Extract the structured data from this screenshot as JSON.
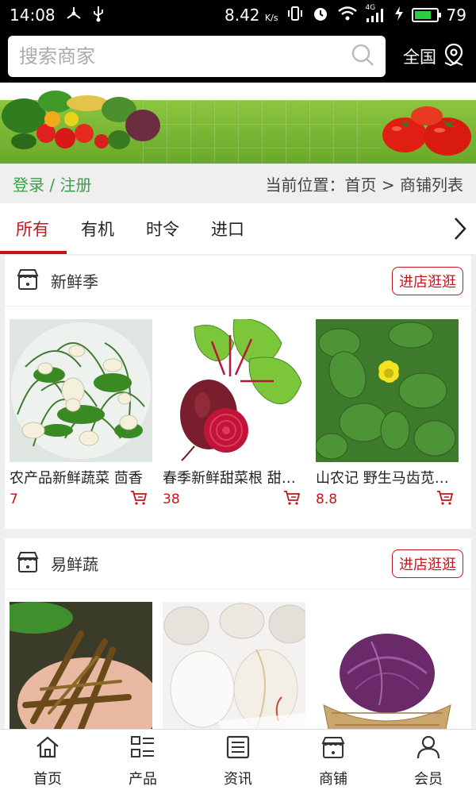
{
  "status_bar": {
    "time": "14:08",
    "speed": "8.42",
    "speed_unit": "K/s",
    "network": "4G",
    "battery_level": 0.79,
    "battery": "79"
  },
  "search": {
    "placeholder": "搜索商家"
  },
  "region": {
    "label": "全国",
    "icon": "location-pin-icon"
  },
  "auth": {
    "login": "登录",
    "separator": "/",
    "register": "注册"
  },
  "breadcrumb": {
    "text": "当前位置：首页 > 商铺列表"
  },
  "tabs": [
    "所有",
    "有机",
    "时令",
    "进口"
  ],
  "active_tab": 0,
  "colors": {
    "accent": "#c4161c",
    "login_green": "#3aa04a",
    "banner_green": "#8cc63f"
  },
  "shops": [
    {
      "name": "新鲜季",
      "visit_label": "进店逛逛",
      "products": [
        {
          "title": "农产品新鲜蔬菜 茴香",
          "price": "7"
        },
        {
          "title": "春季新鲜甜菜根 甜菜头",
          "price": "38"
        },
        {
          "title": "山农记 野生马齿苋 马齿菜",
          "price": "8.8"
        }
      ]
    },
    {
      "name": "易鲜蔬",
      "visit_label": "进店逛逛",
      "products": [
        {
          "title": "",
          "price": ""
        },
        {
          "title": "",
          "price": ""
        },
        {
          "title": "",
          "price": ""
        }
      ]
    }
  ],
  "bottom_nav": [
    {
      "label": "首页",
      "icon": "home-icon"
    },
    {
      "label": "产品",
      "icon": "product-grid-icon"
    },
    {
      "label": "资讯",
      "icon": "news-icon"
    },
    {
      "label": "商铺",
      "icon": "shop-icon"
    },
    {
      "label": "会员",
      "icon": "member-icon"
    }
  ]
}
